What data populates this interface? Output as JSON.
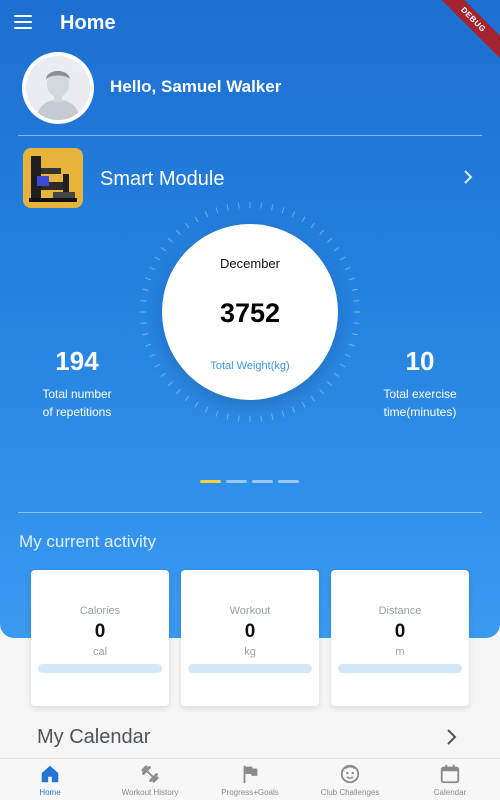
{
  "app": {
    "title": "Home",
    "debug_banner": "DEBUG"
  },
  "user": {
    "greeting": "Hello, Samuel Walker",
    "avatar_icon": "person-silhouette-icon"
  },
  "module": {
    "name": "Smart Module",
    "thumbnail_icon": "gym-machine-icon"
  },
  "summary": {
    "month": "December",
    "total_weight": "3752",
    "total_weight_label": "Total Weight(kg)",
    "repetitions_value": "194",
    "repetitions_label_line1": "Total number",
    "repetitions_label_line2": "of repetitions",
    "exercise_time_value": "10",
    "exercise_time_label_line1": "Total exercise",
    "exercise_time_label_line2": "time(minutes)"
  },
  "pager": {
    "count": 4,
    "active_index": 0,
    "active_color": "#f5d43b"
  },
  "activity": {
    "section_title": "My current activity",
    "cards": [
      {
        "title": "Calories",
        "value": "0",
        "unit": "cal",
        "progress": 0
      },
      {
        "title": "Workout",
        "value": "0",
        "unit": "kg",
        "progress": 0
      },
      {
        "title": "Distance",
        "value": "0",
        "unit": "m",
        "progress": 0
      }
    ]
  },
  "calendar": {
    "title": "My Calendar"
  },
  "bottom_nav": [
    {
      "label": "Home",
      "icon": "home-icon",
      "active": true
    },
    {
      "label": "Workout History",
      "icon": "dumbbell-icon",
      "active": false
    },
    {
      "label": "Progress+Goals",
      "icon": "flag-icon",
      "active": false
    },
    {
      "label": "Club Challenges",
      "icon": "smiley-face-icon",
      "active": false
    },
    {
      "label": "Calendar",
      "icon": "calendar-icon",
      "active": false
    }
  ],
  "colors": {
    "primary": "#2277d6",
    "hero_top": "#1d6fd1",
    "hero_bottom": "#3a9af0",
    "accent_label": "#3c94e8",
    "progress_track": "#d3e7f8"
  }
}
